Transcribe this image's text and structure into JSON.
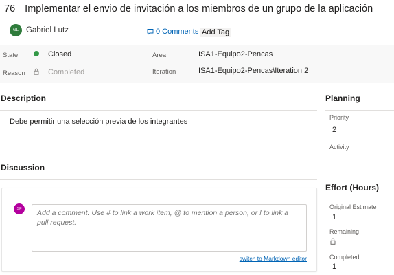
{
  "work_item": {
    "id": "76",
    "title": "Implementar el envio de invitación a los miembros de un grupo de la aplicación",
    "assignee_initials": "GL",
    "assignee": "Gabriel Lutz",
    "comments_label": "0 Comments",
    "add_tag_label": "Add Tag"
  },
  "fields": {
    "state_label": "State",
    "state_value": "Closed",
    "state_color": "#339947",
    "reason_label": "Reason",
    "reason_value": "Completed",
    "area_label": "Area",
    "area_value": "ISA1-Equipo2-Pencas",
    "iteration_label": "Iteration",
    "iteration_value": "ISA1-Equipo2-Pencas\\Iteration 2"
  },
  "description": {
    "heading": "Description",
    "text": "Debe permitir una selección previa de los integrantes"
  },
  "discussion": {
    "heading": "Discussion",
    "user_initials": "SF",
    "placeholder": "Add a comment. Use # to link a work item, @ to mention a person, or ! to link a pull request.",
    "markdown_link": "switch to Markdown editor"
  },
  "planning": {
    "heading": "Planning",
    "priority_label": "Priority",
    "priority_value": "2",
    "activity_label": "Activity",
    "activity_value": ""
  },
  "effort": {
    "heading": "Effort (Hours)",
    "original_estimate_label": "Original Estimate",
    "original_estimate_value": "1",
    "remaining_label": "Remaining",
    "completed_label": "Completed",
    "completed_value": "1"
  },
  "icons": {
    "comment": "comment-icon",
    "lock": "lock-icon"
  }
}
